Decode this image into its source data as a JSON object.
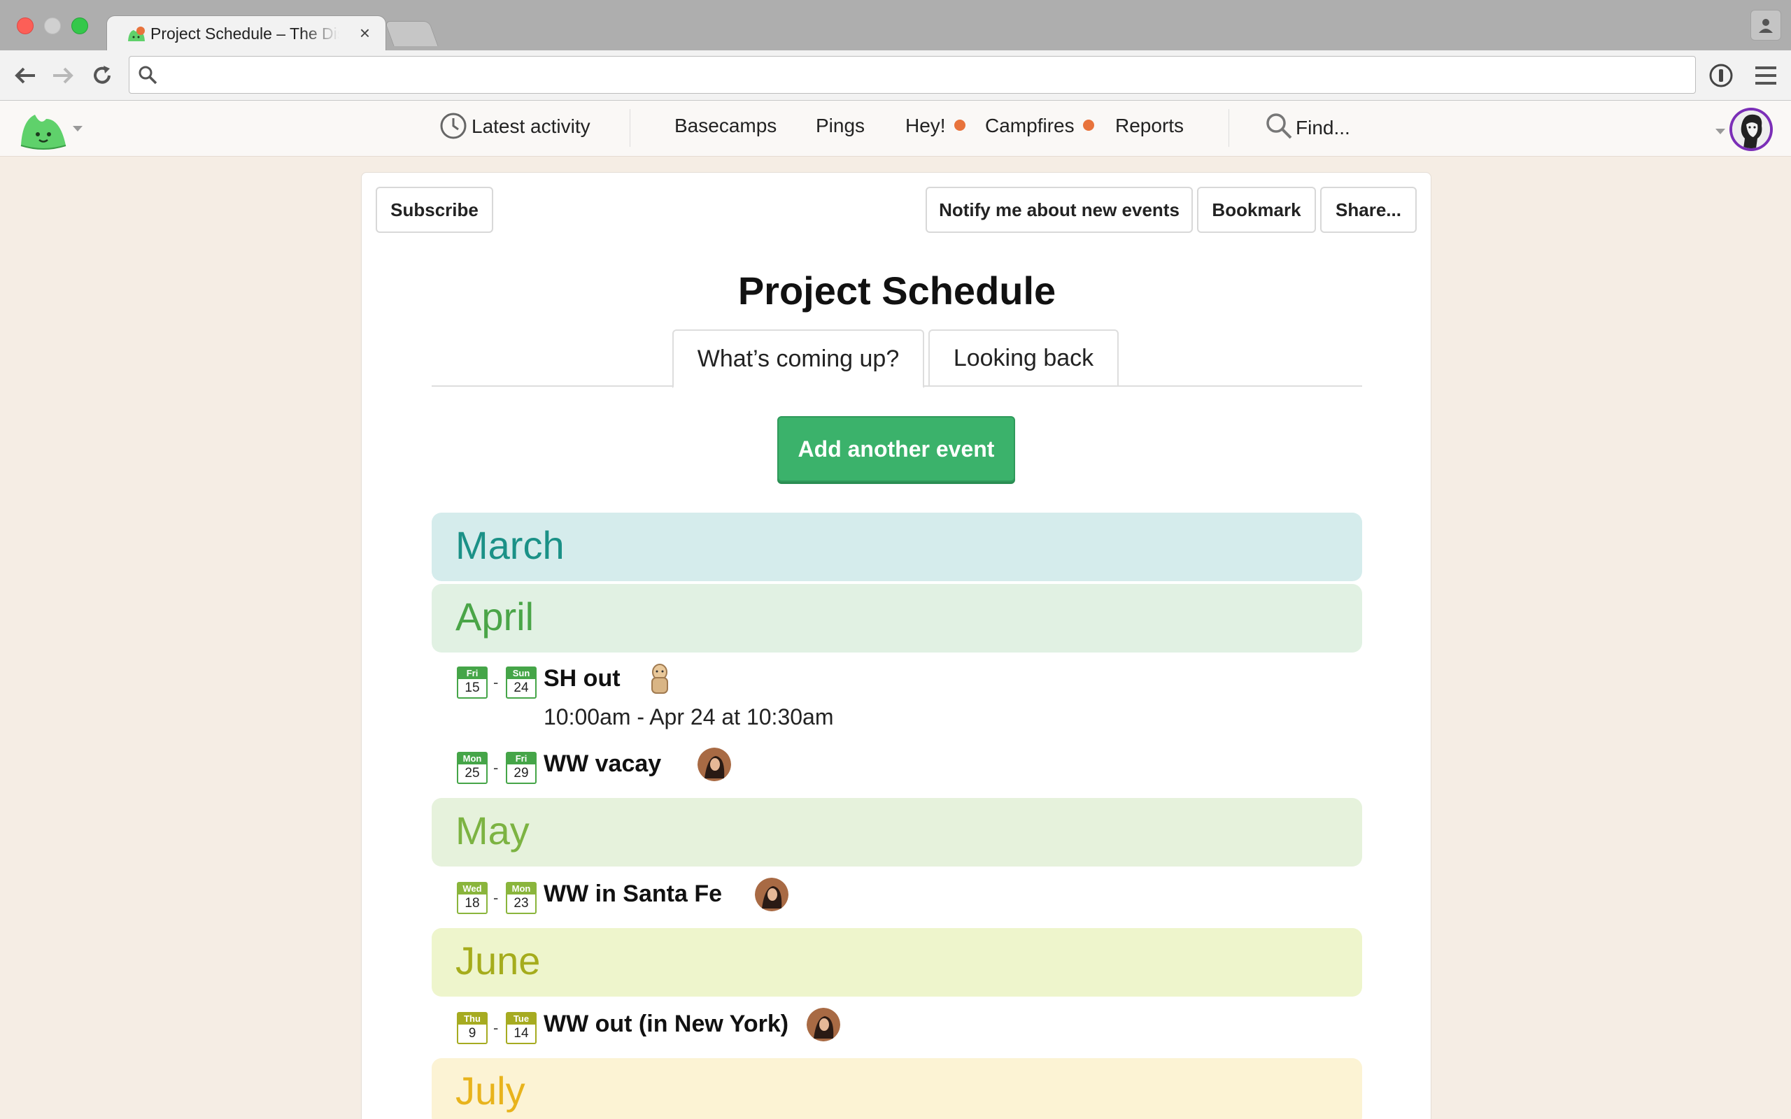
{
  "browser": {
    "tab_title": "Project Schedule – The Distance",
    "tab_close": "×",
    "address_value": "",
    "icons": [
      "back-arrow-icon",
      "forward-arrow-icon",
      "reload-icon",
      "search-icon",
      "password-manager-icon",
      "hamburger-menu-icon",
      "profile-icon"
    ]
  },
  "appnav": {
    "items": [
      {
        "label": "Latest activity",
        "icon": "clock-icon"
      },
      {
        "label": "Basecamps"
      },
      {
        "label": "Pings"
      },
      {
        "label": "Hey!",
        "badge": true
      },
      {
        "label": "Campfires",
        "badge": true
      },
      {
        "label": "Reports"
      },
      {
        "label": "Find...",
        "icon": "magnifier-icon"
      }
    ],
    "badge_color": "#e8733c"
  },
  "toolbar": {
    "subscribe": "Subscribe",
    "notify": "Notify me about new events",
    "bookmark": "Bookmark",
    "share": "Share..."
  },
  "page": {
    "title": "Project Schedule",
    "tabs": [
      "What’s coming up?",
      "Looking back"
    ],
    "add_button": "Add another event",
    "accent": "#3bb26b"
  },
  "months": [
    "March",
    "April",
    "May",
    "June",
    "July"
  ],
  "events": [
    {
      "start_dow": "Fri",
      "start_day": "15",
      "end_dow": "Sun",
      "end_day": "24",
      "title": "SH out",
      "time": "10:00am - Apr 24 at 10:30am"
    },
    {
      "start_dow": "Mon",
      "start_day": "25",
      "end_dow": "Fri",
      "end_day": "29",
      "title": "WW vacay"
    },
    {
      "start_dow": "Wed",
      "start_day": "18",
      "end_dow": "Mon",
      "end_day": "23",
      "title": "WW in Santa Fe"
    },
    {
      "start_dow": "Thu",
      "start_day": "9",
      "end_dow": "Tue",
      "end_day": "14",
      "title": "WW out (in New York)"
    }
  ],
  "dash": "-"
}
